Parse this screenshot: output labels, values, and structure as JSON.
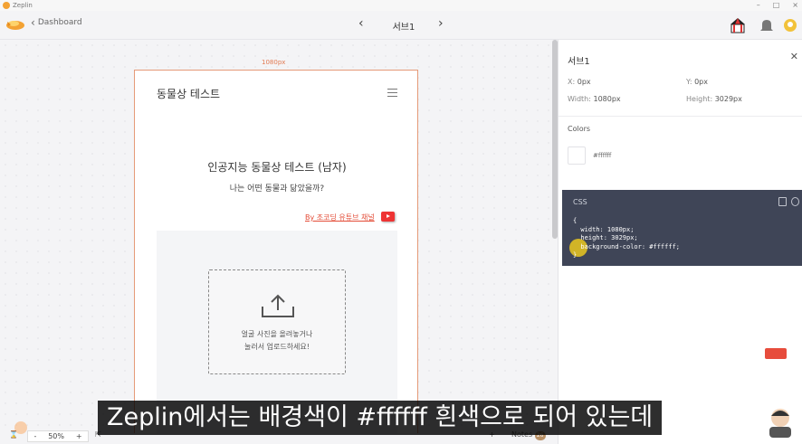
{
  "app": {
    "name": "Zeplin"
  },
  "toolbar": {
    "back_label": "Dashboard",
    "screen_name": "서브1"
  },
  "canvas": {
    "width_tag": "1080px",
    "artboard": {
      "title": "동물상 테스트",
      "heading": "인공지능 동물상 테스트 (남자)",
      "subheading": "나는 어떤 동물과 닮았을까?",
      "link": "By 조코딩 유튜브 채널",
      "upload_text_1": "얼굴 사진을 올려놓거나",
      "upload_text_2": "눌러서 업로드하세요!"
    }
  },
  "panel": {
    "title": "서브1",
    "x_label": "X:",
    "x_value": "0px",
    "y_label": "Y:",
    "y_value": "0px",
    "width_label": "Width:",
    "width_value": "1080px",
    "height_label": "Height:",
    "height_value": "3029px",
    "colors_label": "Colors",
    "swatch_hex": "#ffffff",
    "css_label": "CSS",
    "css_lines": [
      "{",
      "  width: 1080px;",
      "  height: 3029px;",
      "  background-color: #ffffff;",
      "}"
    ]
  },
  "bottom": {
    "zoom": "50%",
    "minus": "-",
    "plus": "+",
    "notes": "Notes",
    "notes_count": "26"
  },
  "subtitle": "Zeplin에서는 배경색이 #ffffff 흰색으로 되어 있는데",
  "colors": {
    "accent": "#e27a52",
    "css_bg": "#3f4557",
    "link": "#e34b36"
  }
}
